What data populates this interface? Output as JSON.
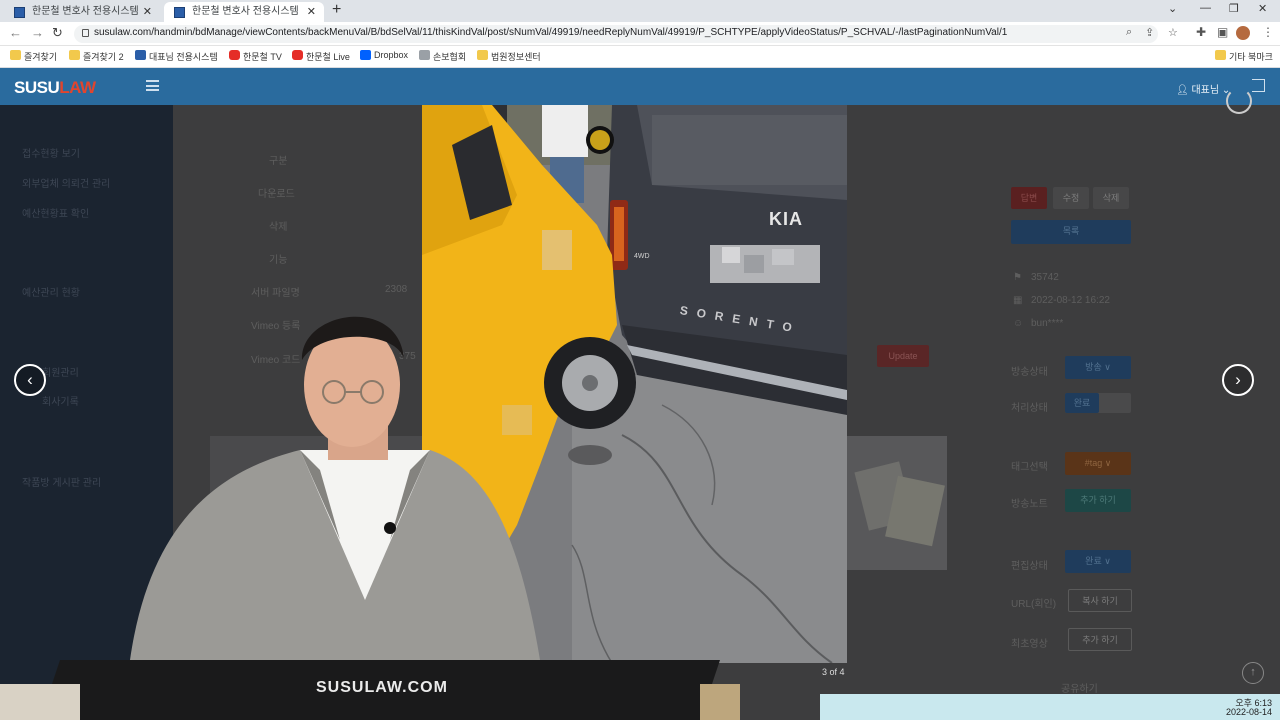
{
  "browser": {
    "tabs": [
      {
        "label": "한문철 변호사 전용시스템",
        "active": false
      },
      {
        "label": "한문철 변호사 전용시스템",
        "active": true
      }
    ],
    "url": "susulaw.com/handmin/bdManage/viewContents/backMenuVal/B/bdSelVal/11/thisKindVal/post/sNumVal/49919/needReplyNumVal/49919/P_SCHTYPE/applyVideoStatus/P_SCHVAL/-/lastPaginationNumVal/1",
    "bookmarks": [
      {
        "label": "즐겨찾기",
        "icon": "folder"
      },
      {
        "label": "즐겨찾기 2",
        "icon": "folder"
      },
      {
        "label": "대표님 전용시스템",
        "icon": "site"
      },
      {
        "label": "한문철 TV",
        "icon": "yt"
      },
      {
        "label": "한문철 Live",
        "icon": "yt"
      },
      {
        "label": "Dropbox",
        "icon": "drop"
      },
      {
        "label": "손보협회",
        "icon": "plain"
      },
      {
        "label": "법원정보센터",
        "icon": "folder"
      }
    ],
    "other_bookmarks": "기타 북마크"
  },
  "app": {
    "logo_a": "SUSU",
    "logo_b": "LAW",
    "user_label": "대표님"
  },
  "sidebar": {
    "items": [
      "접수현황 보기",
      "외부업체 의뢰건 관리",
      "예산현황표 확인",
      "예산관리 현황",
      "회원관리",
      "회사기록",
      "작품방 게시판 관리"
    ]
  },
  "content": {
    "rows": [
      "구분",
      "다운로드",
      "삭제",
      "기능",
      "서버 파일명",
      "Vimeo 등록",
      "Vimeo 코드"
    ],
    "server_file_partial": "2308",
    "vimeo_code_partial": "375",
    "update_button": "Update",
    "actions": [
      "답변",
      "수정",
      "삭제"
    ],
    "list_button": "목록",
    "post_number": "35742",
    "post_date": "2022-08-12 16:22",
    "author": "bun****",
    "labels": [
      "방송상태",
      "처리상태",
      "태그선택",
      "방송노트",
      "편집상태",
      "URL(회인)",
      "최초영상"
    ],
    "broadcast_status_button": "방송 ∨",
    "processing_toggle": "완료",
    "tag_button": "#tag ∨",
    "note_button": "추가 하기",
    "edit_status_button": "완료 ∨",
    "url_button": "복사 하기",
    "original_video_button": "추가 하기",
    "bottom_partial": "공유하기"
  },
  "lightbox": {
    "counter": "3 of 4",
    "car_brand": "KIA",
    "car_model": "SORENTO",
    "car_badge": "4WD"
  },
  "overlay": {
    "desk_text": "SUSULAW.COM"
  },
  "taskbar": {
    "time": "오후 6:13",
    "date": "2022-08-14"
  },
  "colors": {
    "header": "#2a6b9e",
    "logo_accent": "#e1452e",
    "taxi_yellow": "#f2b418",
    "suv_gray": "#3b3e45",
    "taskbar": "#c9e8ee"
  }
}
